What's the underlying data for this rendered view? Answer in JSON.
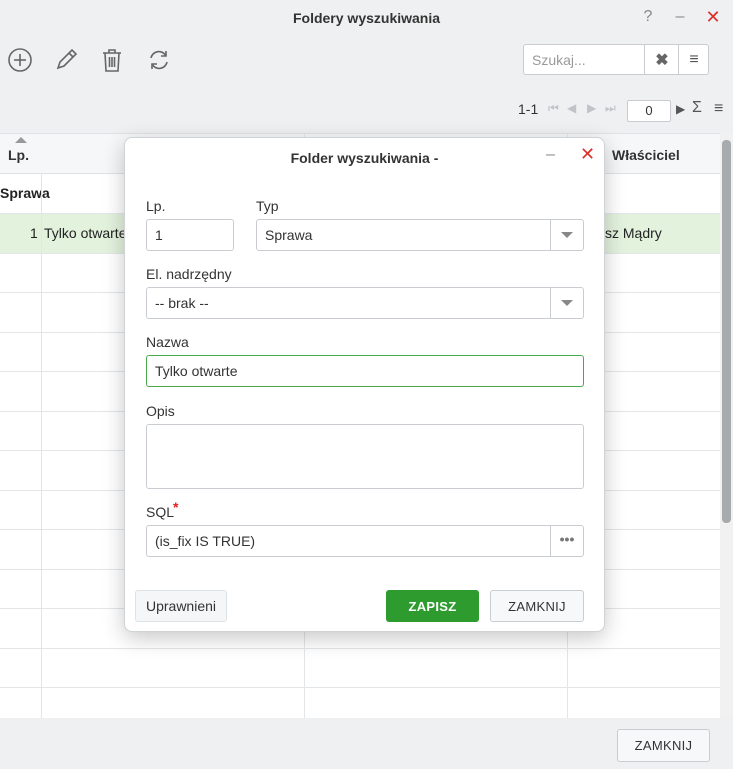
{
  "window": {
    "title": "Foldery wyszukiwania",
    "help_label": "?",
    "minimize_label": "–",
    "close_label": "✕"
  },
  "toolbar": {
    "add_icon": "plus-circle-icon",
    "edit_icon": "pencil-icon",
    "delete_icon": "trash-icon",
    "refresh_icon": "refresh-icon"
  },
  "search": {
    "placeholder": "Szukaj...",
    "clear_label": "✖",
    "menu_label": "≡"
  },
  "pager": {
    "range": "1-1",
    "first": "⏮",
    "prev": "◀",
    "next_disabled": "▶",
    "last": "⏭",
    "page_value": "0",
    "next": "▶",
    "sum": "Σ",
    "menu": "≡"
  },
  "grid": {
    "headers": [
      "Lp.",
      "Właściciel"
    ],
    "group_label": "Sprawa",
    "row": {
      "lp": "1",
      "name": "Tylko otwarte",
      "owner": "sz Mądry"
    }
  },
  "footer": {
    "close_label": "ZAMKNIJ"
  },
  "dialog": {
    "title": "Folder wyszukiwania -",
    "minimize_label": "–",
    "close_label": "✕",
    "lp_label": "Lp.",
    "lp_value": "1",
    "type_label": "Typ",
    "type_value": "Sprawa",
    "parent_label": "El. nadrzędny",
    "parent_value": "-- brak --",
    "name_label": "Nazwa",
    "name_value": "Tylko otwarte",
    "desc_label": "Opis",
    "desc_value": "",
    "sql_label": "SQL",
    "sql_required": "*",
    "sql_value": "(is_fix IS TRUE)",
    "sql_dots": "•••",
    "permissions_label": "Uprawnieni",
    "save_label": "ZAPISZ",
    "dialog_close_label": "ZAMKNIJ"
  },
  "colors": {
    "accent_green": "#2e9b2e",
    "row_highlight": "#e2f2dd",
    "close_red": "#d9302a",
    "required_red": "#e02020"
  }
}
